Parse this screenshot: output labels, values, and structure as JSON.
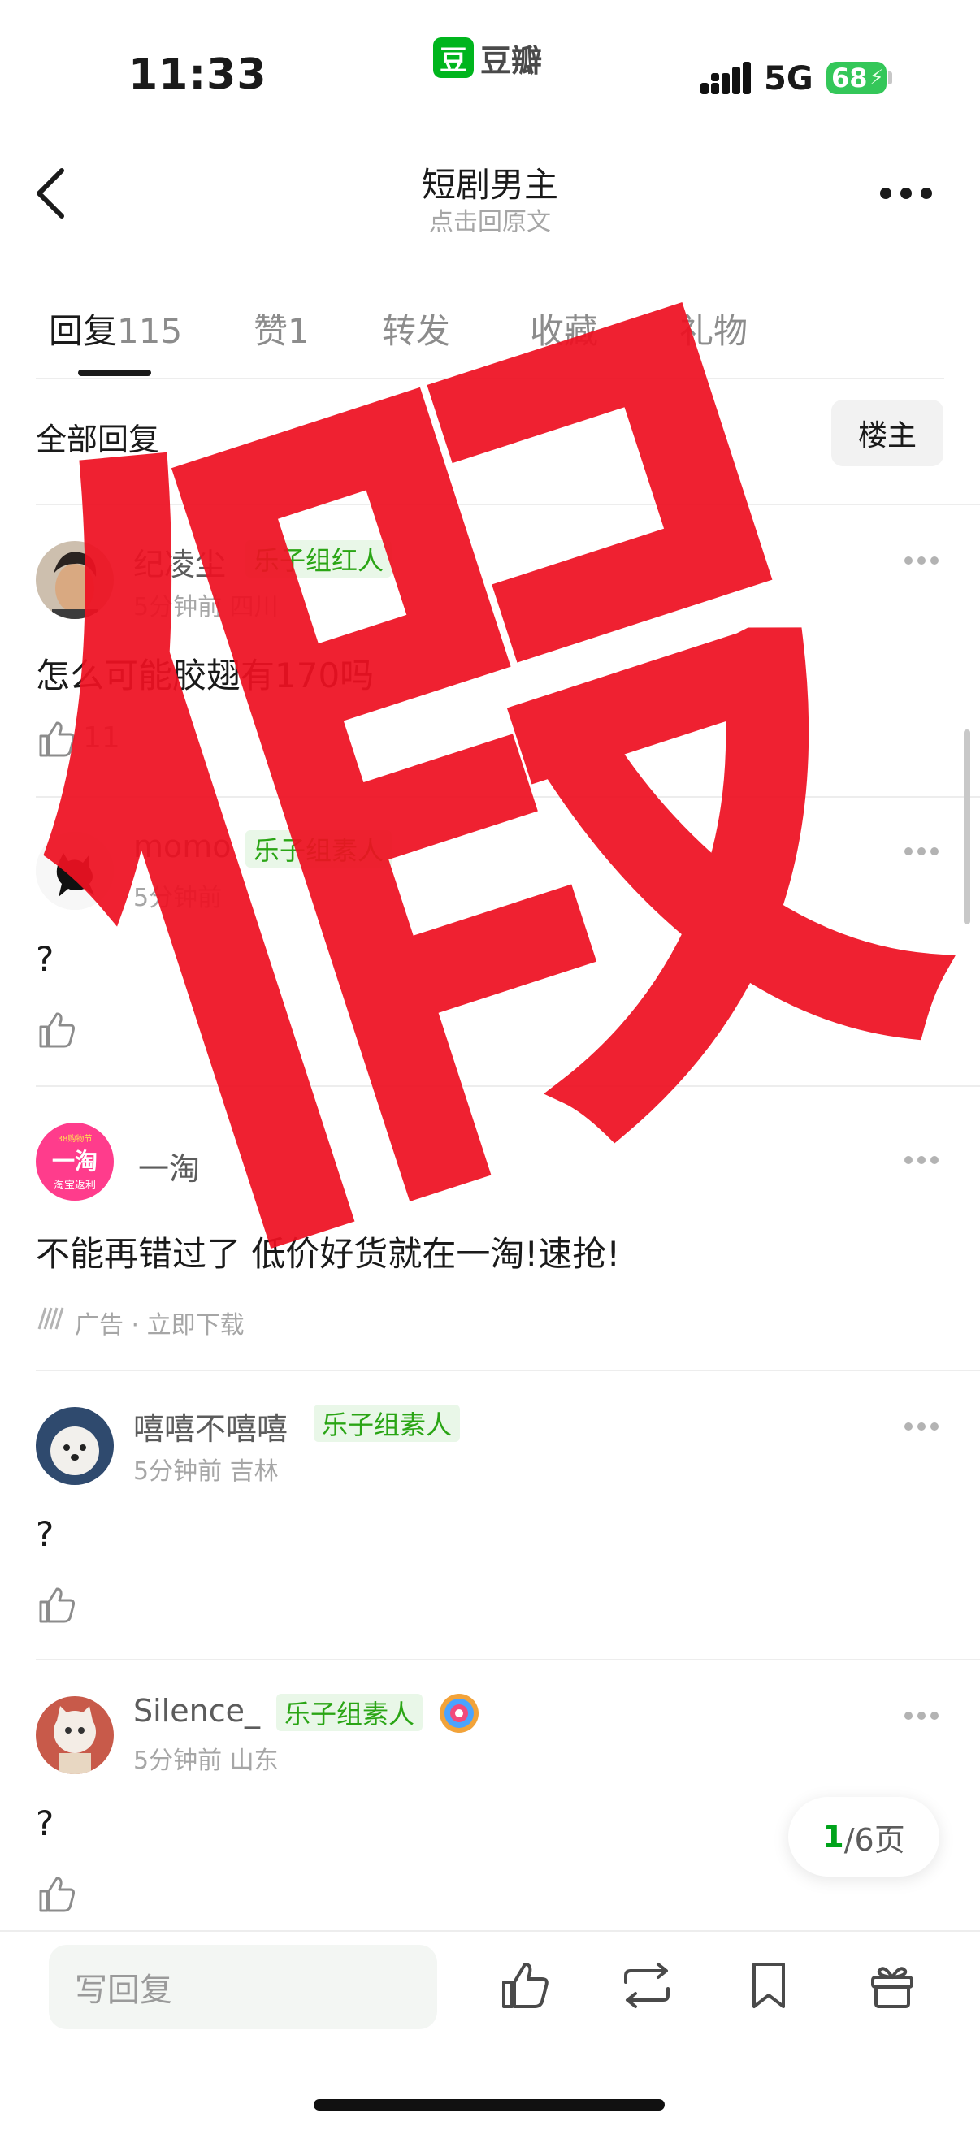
{
  "status_bar": {
    "time": "11:33",
    "app_badge": {
      "logo_char": "豆",
      "name": "豆瓣"
    },
    "network": "5G",
    "battery": "68"
  },
  "nav": {
    "title": "短剧男主",
    "subtitle": "点击回原文"
  },
  "tabs": [
    {
      "label": "回复",
      "count": "115"
    },
    {
      "label": "赞",
      "count": "1"
    },
    {
      "label": "转发",
      "count": ""
    },
    {
      "label": "收藏",
      "count": ""
    },
    {
      "label": "礼物",
      "count": ""
    }
  ],
  "filter": {
    "all_label": "全部回复",
    "op_label": "楼主"
  },
  "comments": [
    {
      "username": "纪凌尘",
      "tag": "乐子组红人",
      "meta": "5分钟前 四川",
      "text": "怎么可能胶翅有170吗",
      "likes": "11"
    },
    {
      "username": "momo",
      "tag": "乐子组素人",
      "meta": "5分钟前",
      "text": "?",
      "likes": ""
    },
    {
      "username": "一淘",
      "is_ad": true,
      "avatar_text": "一淘",
      "avatar_top": "38购物节",
      "avatar_bottom": "淘宝返利",
      "text": "不能再错过了 低价好货就在一淘!速抢!",
      "ad_label": "广告 · 立即下载"
    },
    {
      "username": "嘻嘻不嘻嘻",
      "tag": "乐子组素人",
      "meta": "5分钟前 吉林",
      "text": "?",
      "likes": ""
    },
    {
      "username": "Silence_",
      "tag": "乐子组素人",
      "meta": "5分钟前 山东",
      "text": "?",
      "likes": ""
    }
  ],
  "pager": {
    "current": "1",
    "total_text": "/6页"
  },
  "bottom_bar": {
    "reply_placeholder": "写回复"
  },
  "watermark": {
    "char": "假",
    "color": "#ee1122"
  },
  "colors": {
    "accent": "#00b51d",
    "tag_bg": "#e9f7e8",
    "tag_text": "#2aa515"
  }
}
